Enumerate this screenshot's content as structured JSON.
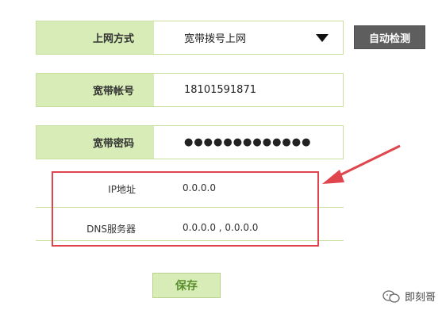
{
  "form": {
    "mode": {
      "label": "上网方式",
      "value": "宽带拨号上网"
    },
    "account": {
      "label": "宽带帐号",
      "value": "18101591871"
    },
    "password": {
      "label": "宽带密码",
      "value": "●●●●●●●●●●●●●"
    }
  },
  "detect_button": {
    "label": "自动检测"
  },
  "info": {
    "ip": {
      "label": "IP地址",
      "value": "0.0.0.0"
    },
    "dns": {
      "label": "DNS服务器",
      "value": "0.0.0.0 , 0.0.0.0"
    }
  },
  "save_button": {
    "label": "保存"
  },
  "watermark": {
    "text": "即刻哥"
  },
  "colors": {
    "label_bg": "#d7ecb6",
    "field_border": "#c9dea0",
    "highlight": "#e0454d",
    "button_dark": "#5e5e5e"
  }
}
